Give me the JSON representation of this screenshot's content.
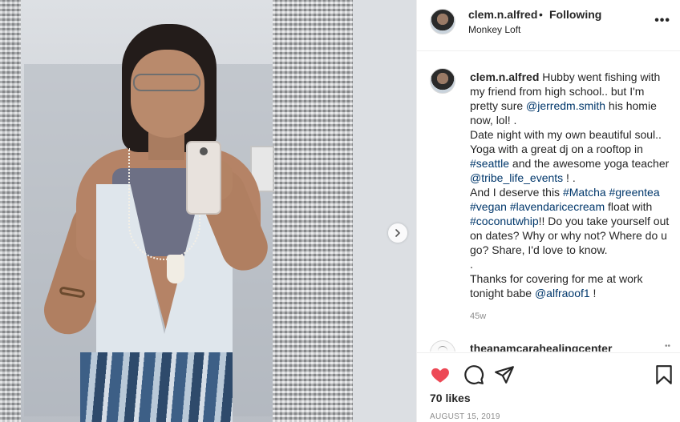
{
  "post": {
    "header": {
      "username": "clem.n.alfred",
      "dot": "•",
      "following": "Following",
      "location": "Monkey Loft",
      "more_icon": "more-horizontal-icon"
    },
    "caption": {
      "username": "clem.n.alfred",
      "p1": "Hubby went fishing with my friend from high school.. but I'm pretty sure ",
      "mention1": "@jerredm.smith",
      "p2": " his homie now, lol! .",
      "p3": "Date night with my own beautiful soul.. Yoga with a great dj on a rooftop in ",
      "tag_seattle": "#seattle",
      "p4": " and the awesome yoga teacher ",
      "mention2": "@tribe_life_events",
      "p5": " ! .",
      "p6": "And I deserve this ",
      "tag_matcha": "#Matcha",
      "tag_greentea": "#greentea",
      "tag_vegan": "#vegan",
      "tag_lavender": "#lavendaricecream",
      "p7": " float with ",
      "tag_coconut": "#coconutwhip",
      "p8": "!! Do you take yourself out on dates? Why or why not? Where do u go? Share, I'd love to know.",
      "p9": ".",
      "p10": "Thanks for covering for me at work tonight babe ",
      "mention3": "@alfraoof1",
      "p11": " !"
    },
    "timestamp": "45w",
    "comment": {
      "username": "theanamcarahealingcenter",
      "more": "••"
    },
    "likes": "70 likes",
    "date": "AUGUST 15, 2019",
    "colors": {
      "like": "#ed4956",
      "link": "#00376b",
      "muted": "#8e8e8e"
    },
    "icons": [
      "heart-icon",
      "comment-icon",
      "share-icon",
      "bookmark-icon",
      "chevron-right-icon"
    ]
  }
}
